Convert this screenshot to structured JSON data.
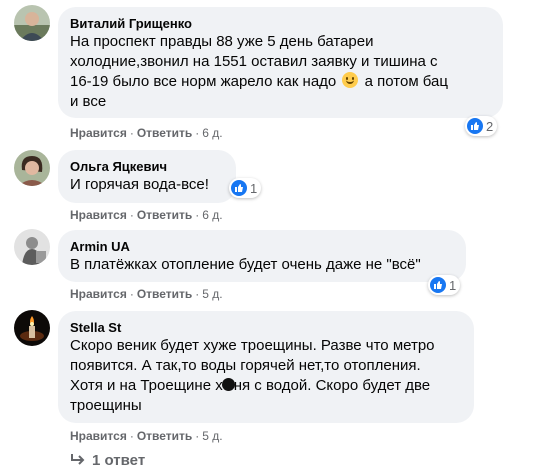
{
  "comments": [
    {
      "author": "Виталий Грищенко",
      "lines": [
        "На проспект правды 88 уже 5 день батареи",
        "холодние,звонил на 1551 оставил заявку и тишина с",
        "16-19 было все норм жарело как надо",
        "а потом бац",
        "и все"
      ],
      "reactions": "2",
      "like": "Нравится",
      "reply": "Ответить",
      "time": "6 д."
    },
    {
      "author": "Ольга Яцкевич",
      "lines": [
        "И горячая вода-все!"
      ],
      "reactions": "1",
      "like": "Нравится",
      "reply": "Ответить",
      "time": "6 д."
    },
    {
      "author": "Armin UA",
      "lines": [
        "В платёжках отопление будет очень даже не \"всё\""
      ],
      "reactions": "1",
      "like": "Нравится",
      "reply": "Ответить",
      "time": "5 д."
    },
    {
      "author": "Stella St",
      "lines": [
        "Скоро веник будет хуже троещины. Разве что метро",
        "появится. А так,то воды горячей нет,то отопления.",
        "Хотя и на Троещине х",
        "ня с водой. Скоро будет две",
        "троещины"
      ],
      "like": "Нравится",
      "reply": "Ответить",
      "time": "5 д."
    }
  ],
  "replies_link": "1 ответ",
  "icons": {
    "like": "thumbs-up-icon",
    "smile": "smiling-face-emoji",
    "reply_arrow": "reply-arrow-icon"
  },
  "colors": {
    "bubble": "#f0f2f5",
    "like_blue": "#1877f2",
    "meta_gray": "#65676b"
  }
}
